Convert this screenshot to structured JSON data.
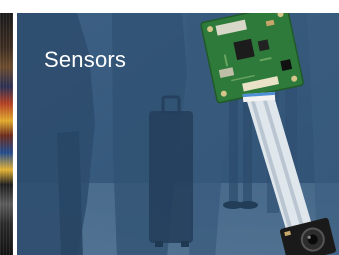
{
  "tiles": {
    "prev": {
      "name": "previous-category-tile"
    },
    "current": {
      "title": "Sensors",
      "accent_color": "#385a7b",
      "overlay_color": "#34587c"
    }
  },
  "icons": {
    "sensor_board": "circuit-board-icon",
    "camera_module": "camera-module-icon",
    "ribbon_cable": "ribbon-cable-icon"
  }
}
